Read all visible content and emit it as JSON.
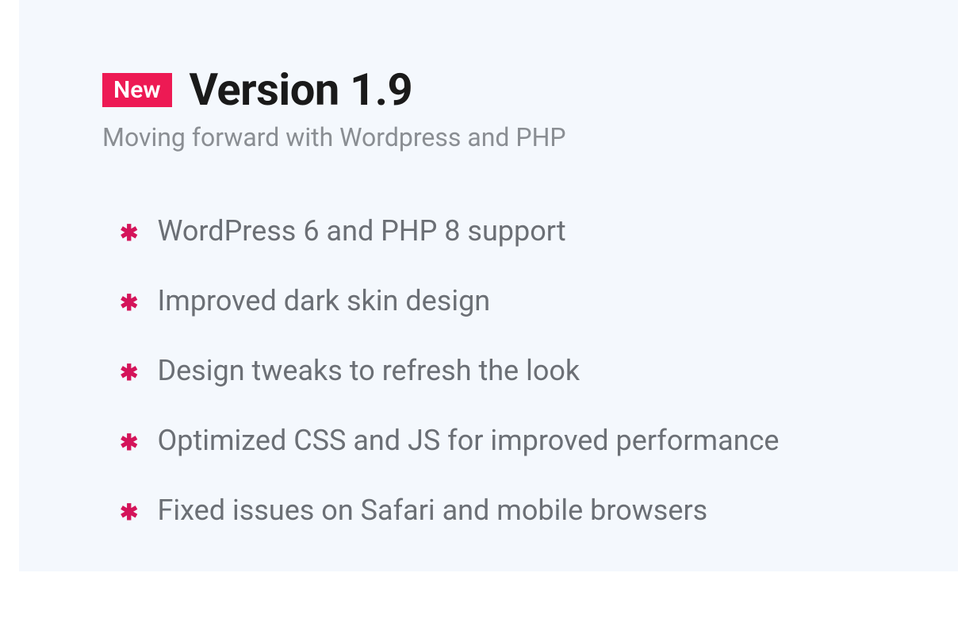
{
  "badge": "New",
  "title": "Version 1.9",
  "subtitle": "Moving forward with Wordpress and PHP",
  "features": [
    "WordPress 6 and PHP 8 support",
    "Improved dark skin design",
    "Design tweaks to refresh the look",
    "Optimized CSS and JS for improved performance",
    "Fixed issues on Safari and mobile browsers"
  ]
}
